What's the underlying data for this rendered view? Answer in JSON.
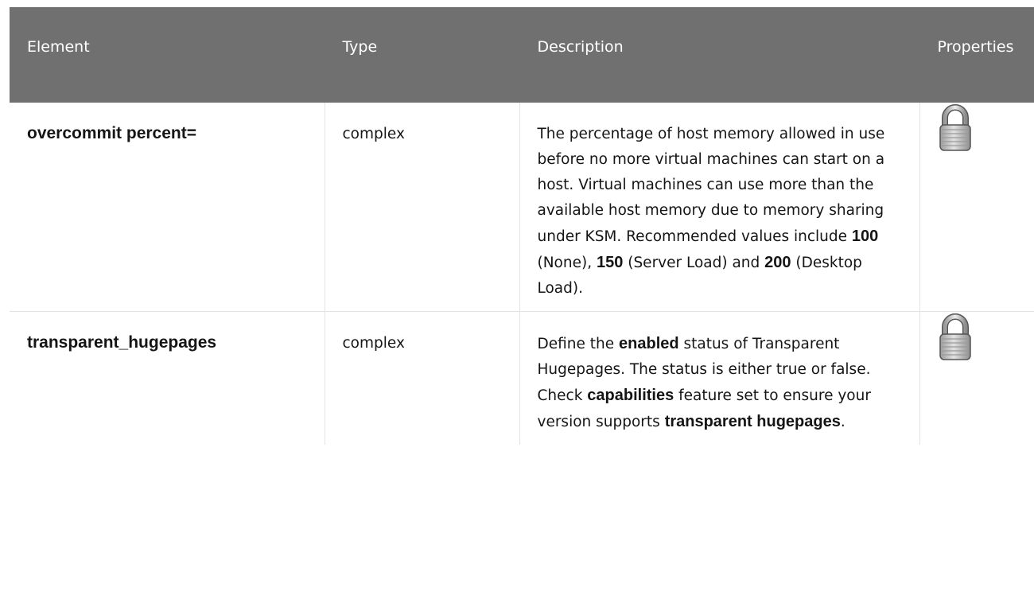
{
  "table": {
    "headers": [
      "Element",
      "Type",
      "Description",
      "Properties"
    ],
    "rows": [
      {
        "element": "overcommit percent=",
        "type": "complex",
        "description": [
          {
            "t": "The percentage of host memory allowed in use before no more virtual machines can start on a host. Virtual machines can use more than the available host memory due to memory sharing under KSM. Recommended values include "
          },
          {
            "t": "100",
            "b": true
          },
          {
            "t": " (None), "
          },
          {
            "t": "150",
            "b": true
          },
          {
            "t": " (Server Load) and "
          },
          {
            "t": "200",
            "b": true
          },
          {
            "t": " (Desktop Load)."
          }
        ],
        "properties_icon": "padlock-icon"
      },
      {
        "element": "transparent_hugepages",
        "type": "complex",
        "description": [
          {
            "t": "Define the "
          },
          {
            "t": "enabled",
            "b": true
          },
          {
            "t": " status of Transparent Hugepages. The status is either true or false. Check "
          },
          {
            "t": "capabilities",
            "b": true
          },
          {
            "t": " feature set to ensure your version supports "
          },
          {
            "t": "transparent hugepages",
            "b": true
          },
          {
            "t": "."
          }
        ],
        "properties_icon": "padlock-icon"
      }
    ]
  }
}
